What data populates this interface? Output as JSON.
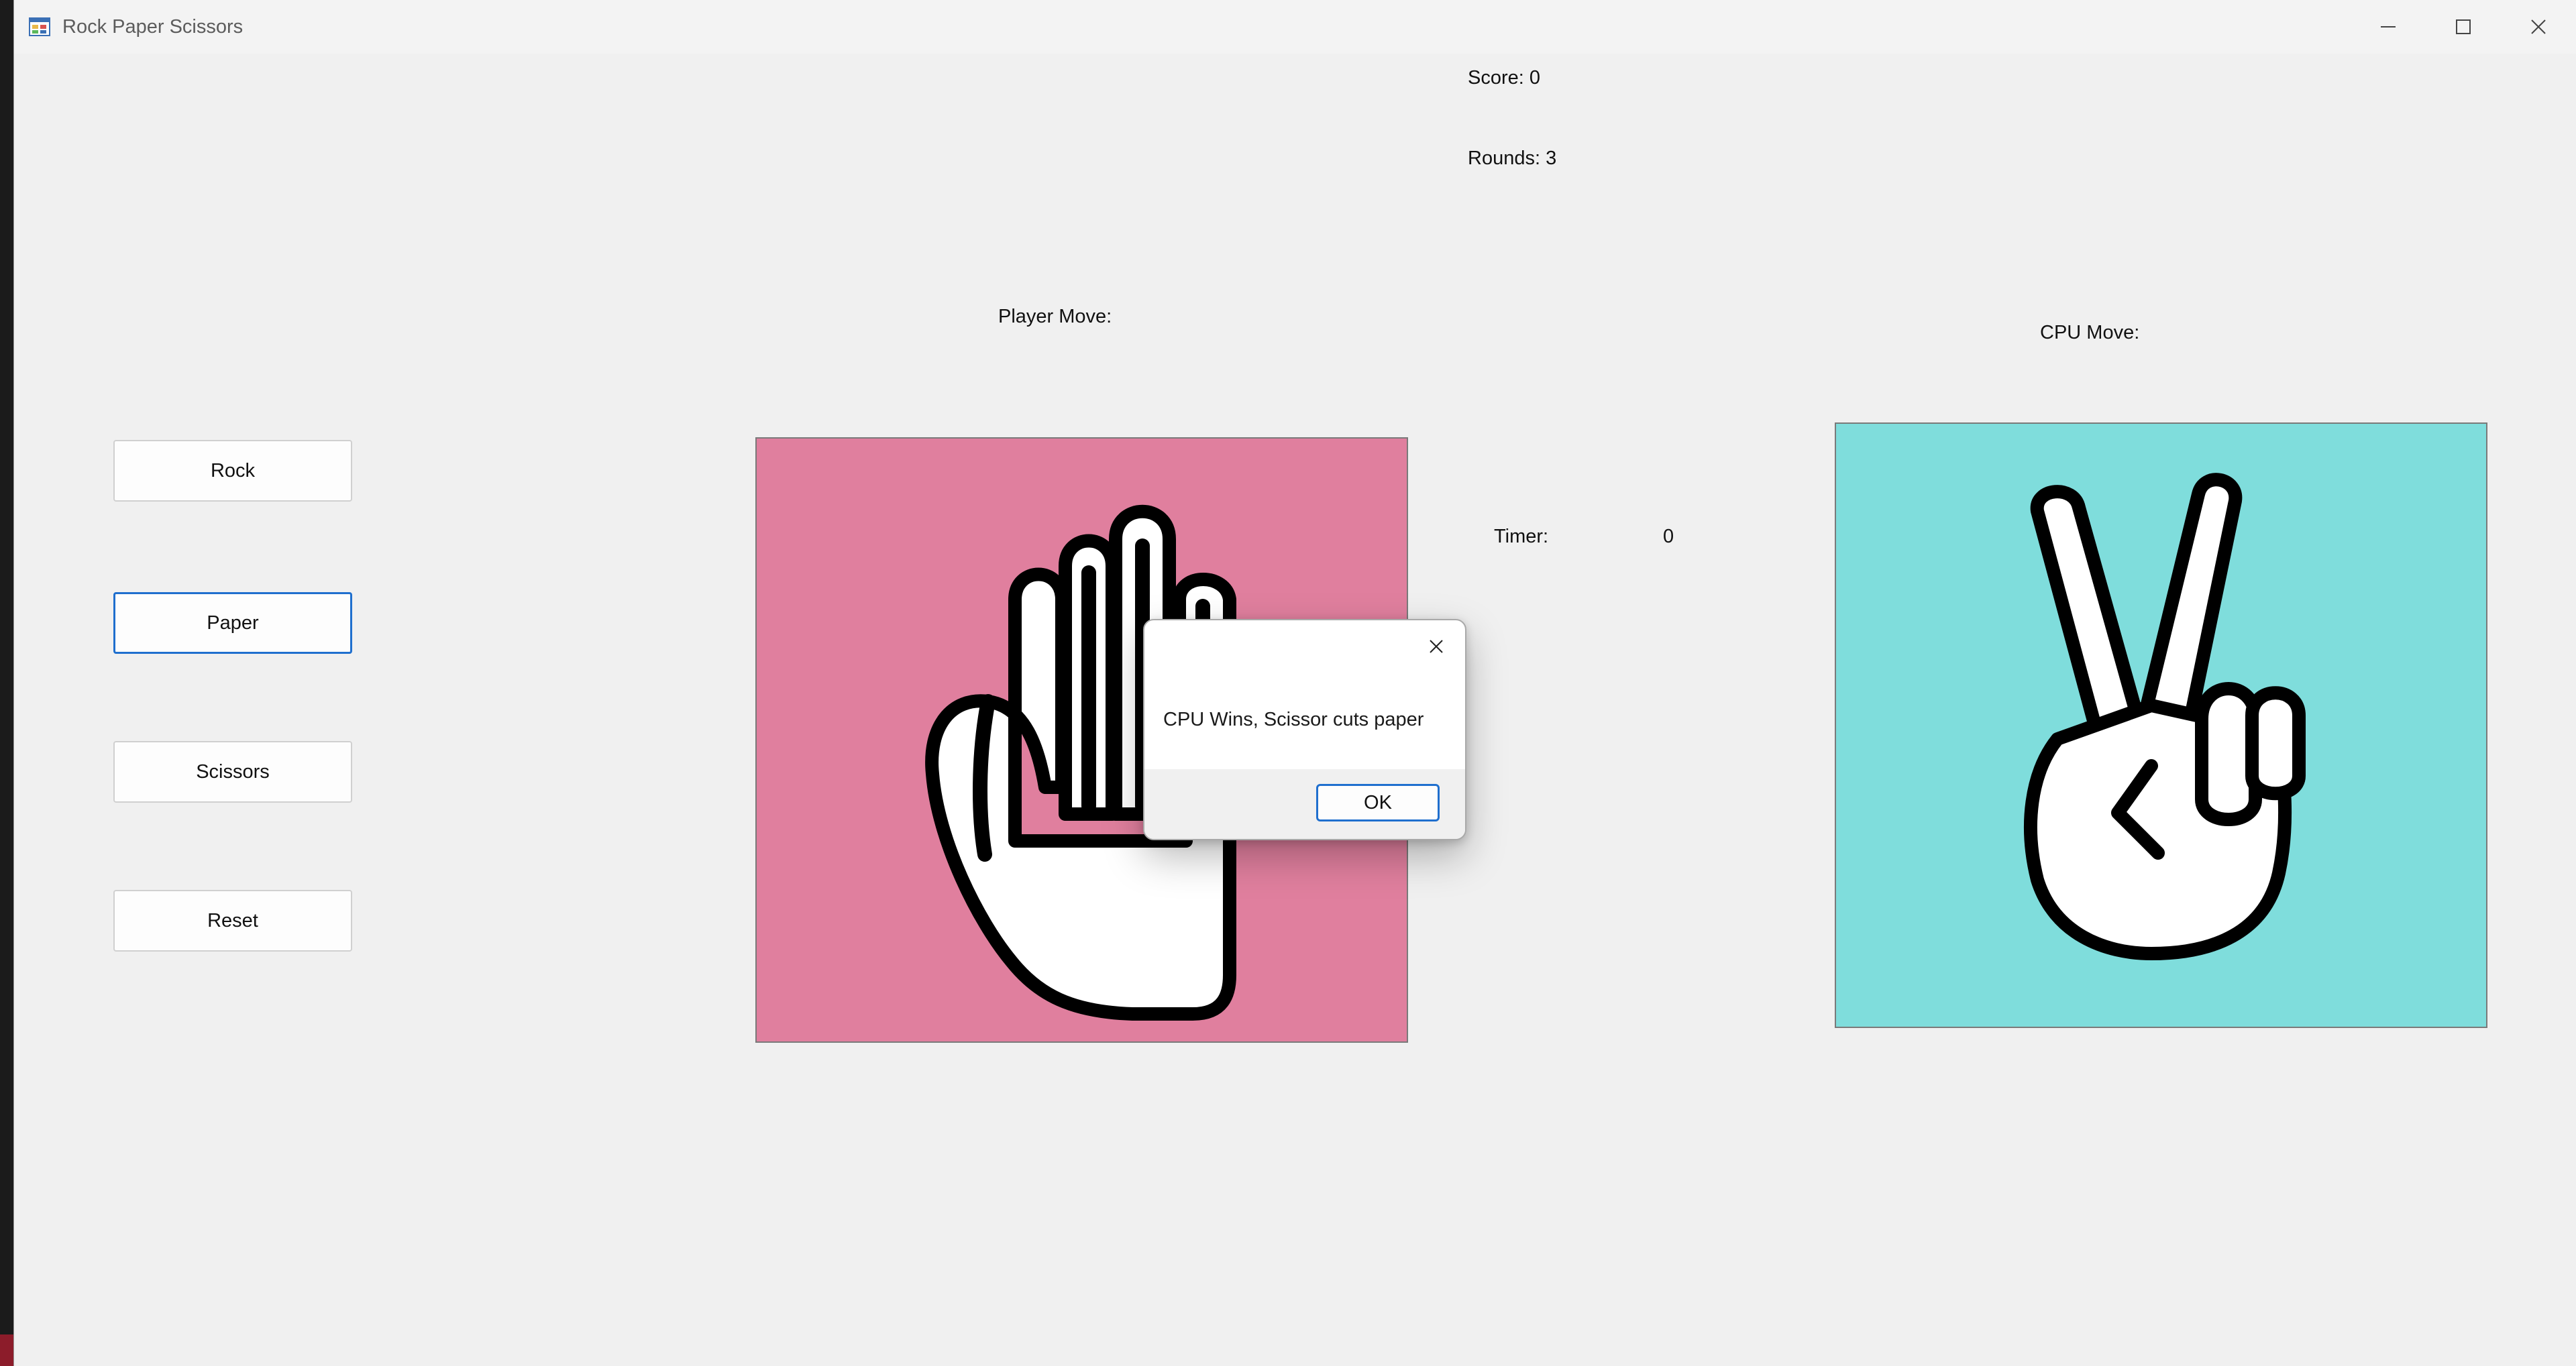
{
  "window": {
    "title": "Rock Paper Scissors",
    "app_icon": "winforms-app-icon",
    "controls": [
      "minimize-icon",
      "maximize-icon",
      "close-icon"
    ]
  },
  "stats": {
    "score_label": "Score: 0",
    "rounds_label": "Rounds: 3",
    "timer_label": "Timer:",
    "timer_value": "0"
  },
  "moves": {
    "player_label": "Player Move:",
    "cpu_label": "CPU Move:",
    "player_image": "paper-hand-icon",
    "cpu_image": "scissors-hand-icon",
    "player_bg": "#e07f9e",
    "cpu_bg": "#7fdddc"
  },
  "buttons": {
    "rock": "Rock",
    "paper": "Paper",
    "scissors": "Scissors",
    "reset": "Reset"
  },
  "dialog": {
    "message": "CPU Wins, Scissor cuts paper",
    "ok_label": "OK"
  },
  "colors": {
    "focus_accent": "#1f6fce",
    "window_bg": "#f0f0f0"
  }
}
